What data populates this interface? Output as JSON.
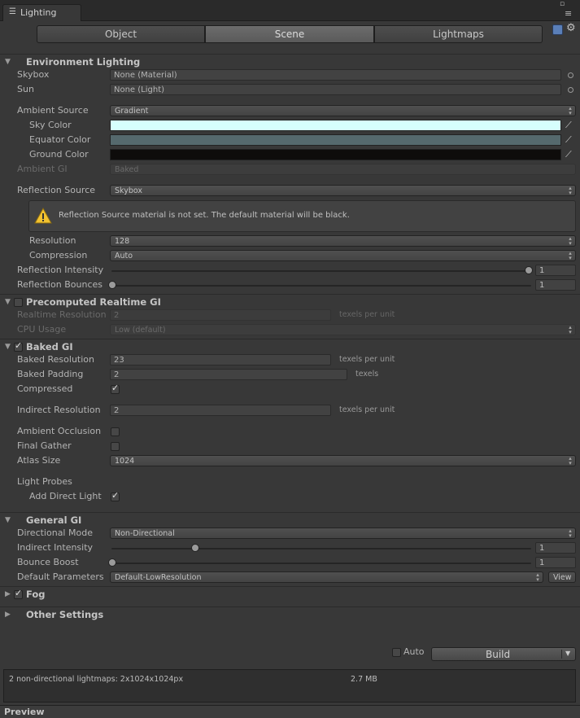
{
  "window": {
    "tab_title": "Lighting"
  },
  "tabs": [
    "Object",
    "Scene",
    "Lightmaps"
  ],
  "env": {
    "title": "Environment Lighting",
    "skybox_label": "Skybox",
    "skybox_value": "None (Material)",
    "sun_label": "Sun",
    "sun_value": "None (Light)",
    "ambient_source_label": "Ambient Source",
    "ambient_source_value": "Gradient",
    "sky_color_label": "Sky Color",
    "sky_color": "#d6fffd",
    "equator_color_label": "Equator Color",
    "equator_color": "#55696d",
    "ground_color_label": "Ground Color",
    "ground_color": "#0e0c0b",
    "ambient_gi_label": "Ambient GI",
    "ambient_gi_value": "Baked",
    "reflection_source_label": "Reflection Source",
    "reflection_source_value": "Skybox",
    "warning": "Reflection Source material is not set. The default material will be black.",
    "resolution_label": "Resolution",
    "resolution_value": "128",
    "compression_label": "Compression",
    "compression_value": "Auto",
    "reflection_intensity_label": "Reflection Intensity",
    "reflection_intensity_value": "1",
    "reflection_intensity_fraction": 1.0,
    "reflection_bounces_label": "Reflection Bounces",
    "reflection_bounces_value": "1",
    "reflection_bounces_fraction": 0.0
  },
  "realtime": {
    "title": "Precomputed Realtime GI",
    "enabled": false,
    "resolution_label": "Realtime Resolution",
    "resolution_value": "2",
    "resolution_unit": "texels per unit",
    "cpu_usage_label": "CPU Usage",
    "cpu_usage_value": "Low (default)"
  },
  "baked": {
    "title": "Baked GI",
    "enabled": true,
    "resolution_label": "Baked Resolution",
    "resolution_value": "23",
    "resolution_unit": "texels per unit",
    "padding_label": "Baked Padding",
    "padding_value": "2",
    "padding_unit": "texels",
    "compressed_label": "Compressed",
    "compressed": true,
    "indirect_resolution_label": "Indirect Resolution",
    "indirect_resolution_value": "2",
    "indirect_resolution_unit": "texels per unit",
    "ambient_occlusion_label": "Ambient Occlusion",
    "ambient_occlusion": false,
    "final_gather_label": "Final Gather",
    "final_gather": false,
    "atlas_size_label": "Atlas Size",
    "atlas_size_value": "1024",
    "light_probes_label": "Light Probes",
    "add_direct_light_label": "Add Direct Light",
    "add_direct_light": true
  },
  "general": {
    "title": "General GI",
    "directional_mode_label": "Directional Mode",
    "directional_mode_value": "Non-Directional",
    "indirect_intensity_label": "Indirect Intensity",
    "indirect_intensity_value": "1",
    "indirect_intensity_fraction": 0.2,
    "bounce_boost_label": "Bounce Boost",
    "bounce_boost_value": "1",
    "bounce_boost_fraction": 0.0,
    "default_parameters_label": "Default Parameters",
    "default_parameters_value": "Default-LowResolution",
    "view_button": "View"
  },
  "fog": {
    "title": "Fog",
    "enabled": true
  },
  "other": {
    "title": "Other Settings"
  },
  "build": {
    "auto_label": "Auto",
    "auto": false,
    "build_label": "Build"
  },
  "status": {
    "lightmaps": "2 non-directional lightmaps: 2x1024x1024px",
    "size": "2.7 MB"
  },
  "preview": {
    "label": "Preview"
  }
}
